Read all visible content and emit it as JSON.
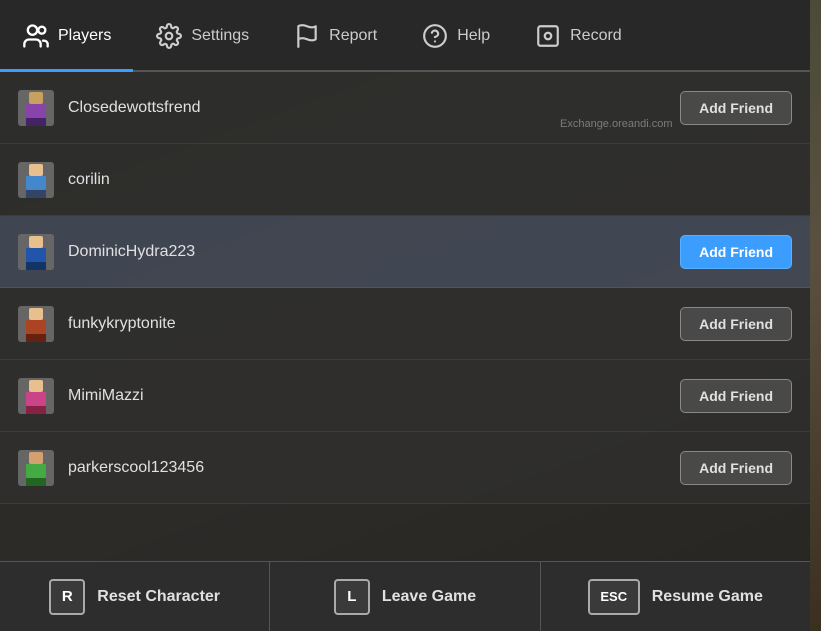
{
  "nav": {
    "items": [
      {
        "id": "players",
        "label": "Players",
        "active": true
      },
      {
        "id": "settings",
        "label": "Settings",
        "active": false
      },
      {
        "id": "report",
        "label": "Report",
        "active": false
      },
      {
        "id": "help",
        "label": "Help",
        "active": false
      },
      {
        "id": "record",
        "label": "Record",
        "active": false
      }
    ]
  },
  "players": [
    {
      "id": 1,
      "name": "Closedewottsfrend",
      "highlighted": false,
      "hasAddFriend": true,
      "btnBlue": false
    },
    {
      "id": 2,
      "name": "corilin",
      "highlighted": false,
      "hasAddFriend": false,
      "btnBlue": false
    },
    {
      "id": 3,
      "name": "DominicHydra223",
      "highlighted": true,
      "hasAddFriend": true,
      "btnBlue": true
    },
    {
      "id": 4,
      "name": "funkykryptonite",
      "highlighted": false,
      "hasAddFriend": true,
      "btnBlue": false
    },
    {
      "id": 5,
      "name": "MimiMazzi",
      "highlighted": false,
      "hasAddFriend": true,
      "btnBlue": false
    },
    {
      "id": 6,
      "name": "parkerscool123456",
      "highlighted": false,
      "hasAddFriend": true,
      "btnBlue": false
    }
  ],
  "addFriendLabel": "Add Friend",
  "watermark": "Exchange.oreandi.com",
  "actions": [
    {
      "id": "reset",
      "key": "R",
      "label": "Reset Character"
    },
    {
      "id": "leave",
      "key": "L",
      "label": "Leave Game"
    },
    {
      "id": "resume",
      "key": "ESC",
      "label": "Resume Game"
    }
  ]
}
